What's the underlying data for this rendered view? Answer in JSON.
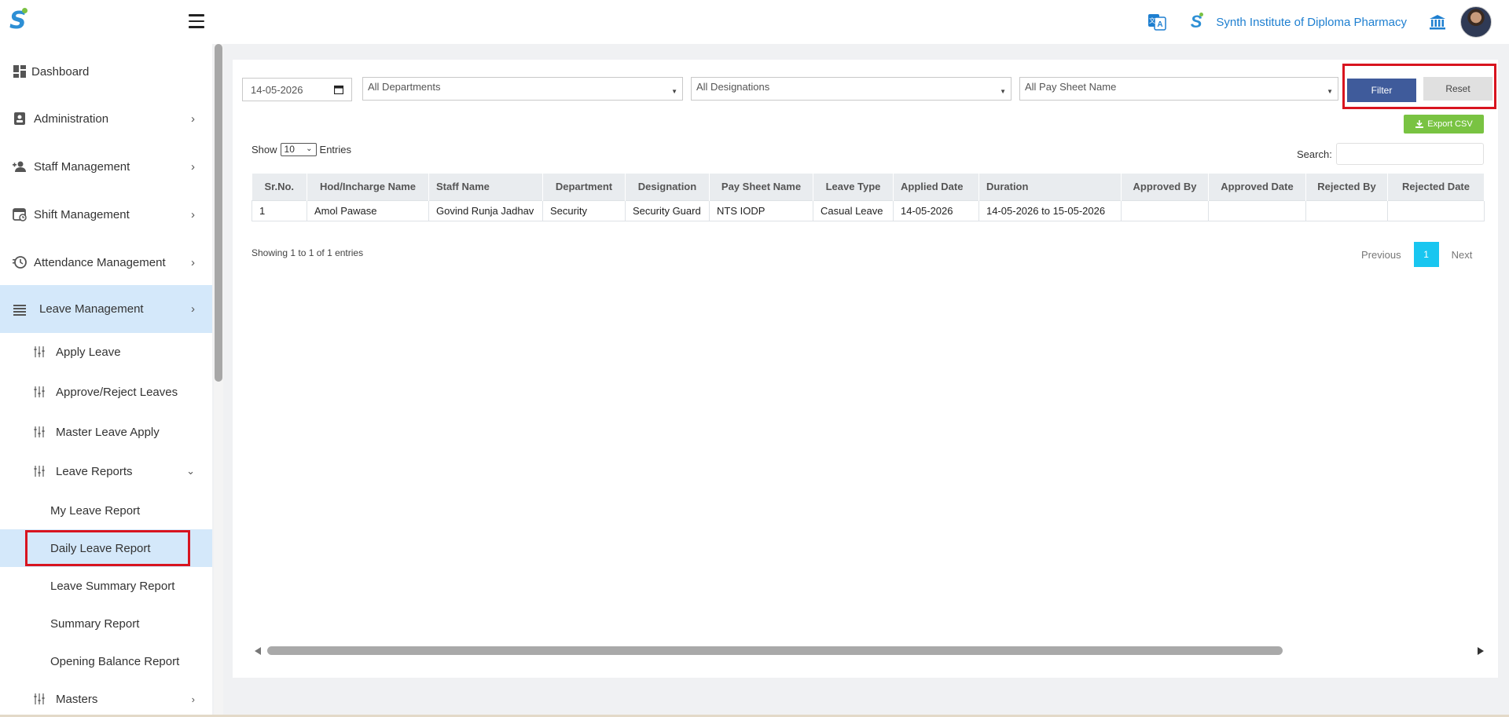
{
  "header": {
    "institute_name": "Synth Institute of Diploma Pharmacy",
    "logo_letter": "S",
    "brand_color": "#2d8fd5",
    "accent_color": "#7ac143",
    "icons": [
      "menu-icon",
      "translate-icon",
      "institution-icon",
      "user-avatar"
    ]
  },
  "sidebar": {
    "items": [
      {
        "label": "Dashboard",
        "icon": "dashboard-icon"
      },
      {
        "label": "Administration",
        "icon": "admin-icon"
      },
      {
        "label": "Staff Management",
        "icon": "staff-icon"
      },
      {
        "label": "Shift Management",
        "icon": "calendar-icon"
      },
      {
        "label": "Attendance Management",
        "icon": "clock-icon"
      },
      {
        "label": "Leave Management",
        "icon": "list-icon",
        "active": true
      }
    ],
    "leave_sub": [
      {
        "label": "Apply Leave"
      },
      {
        "label": "Approve/Reject Leaves"
      },
      {
        "label": "Master Leave Apply"
      },
      {
        "label": "Leave Reports"
      }
    ],
    "reports_sub": [
      {
        "label": "My Leave Report"
      },
      {
        "label": "Daily Leave Report",
        "active": true
      },
      {
        "label": "Leave Summary Report"
      },
      {
        "label": "Summary Report"
      },
      {
        "label": "Opening Balance Report"
      }
    ],
    "masters": {
      "label": "Masters"
    }
  },
  "filters": {
    "date": "14-05-2026",
    "department": "All Departments",
    "designation": "All Designations",
    "pay_sheet": "All Pay Sheet Name",
    "filter_label": "Filter",
    "reset_label": "Reset",
    "export_label": "Export CSV"
  },
  "table_controls": {
    "show_label": "Show",
    "entries_value": "10",
    "entries_label": "Entries",
    "search_label": "Search:"
  },
  "table": {
    "headers": [
      "Sr.No.",
      "Hod/Incharge Name",
      "Staff Name",
      "Department",
      "Designation",
      "Pay Sheet Name",
      "Leave Type",
      "Applied Date",
      "Duration",
      "Approved By",
      "Approved Date",
      "Rejected By",
      "Rejected Date"
    ],
    "rows": [
      [
        "1",
        "Amol Pawase",
        "Govind Runja Jadhav",
        "Security",
        "Security Guard",
        "NTS IODP",
        "Casual Leave",
        "14-05-2026",
        "14-05-2026 to 15-05-2026",
        "",
        "",
        "",
        ""
      ]
    ]
  },
  "footer": {
    "showing": "Showing 1 to 1 of 1 entries",
    "previous": "Previous",
    "page": "1",
    "next": "Next"
  }
}
